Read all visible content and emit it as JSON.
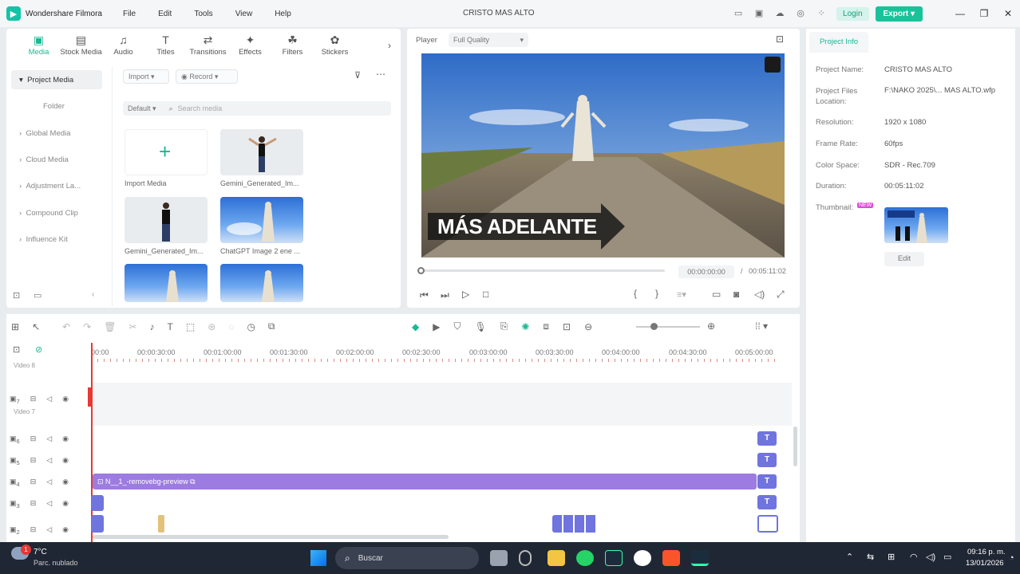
{
  "app": {
    "name": "Wondershare Filmora",
    "project_title": "CRISTO MAS ALTO"
  },
  "menu": [
    "File",
    "Edit",
    "Tools",
    "View",
    "Help"
  ],
  "titlebar": {
    "login": "Login",
    "export": "Export"
  },
  "media_tabs": [
    {
      "label": "Media",
      "icon": "media-icon"
    },
    {
      "label": "Stock Media",
      "icon": "stock-media-icon"
    },
    {
      "label": "Audio",
      "icon": "audio-icon"
    },
    {
      "label": "Titles",
      "icon": "titles-icon"
    },
    {
      "label": "Transitions",
      "icon": "transitions-icon"
    },
    {
      "label": "Effects",
      "icon": "effects-icon"
    },
    {
      "label": "Filters",
      "icon": "filters-icon"
    },
    {
      "label": "Stickers",
      "icon": "stickers-icon"
    }
  ],
  "sidebar": {
    "items": [
      "Project Media",
      "Folder",
      "Global Media",
      "Cloud Media",
      "Adjustment La...",
      "Compound Clip",
      "Influence Kit"
    ]
  },
  "media": {
    "import": "Import",
    "record": "Record",
    "sort": "Default",
    "search_placeholder": "Search media",
    "items": [
      "Import Media",
      "Gemini_Generated_Im...",
      "Gemini_Generated_Im...",
      "ChatGPT Image 2 ene ..."
    ]
  },
  "player": {
    "label": "Player",
    "quality": "Full Quality",
    "overlay_text": "MÁS ADELANTE",
    "current_time": "00:00:00:00",
    "separator": "/",
    "total_time": "00:05:11:02"
  },
  "project_info": {
    "tab": "Project Info",
    "fields": [
      {
        "label": "Project Name:",
        "value": "CRISTO MAS ALTO"
      },
      {
        "label": "Project Files Location:",
        "value": "F:\\NAKO 2025\\... MAS ALTO.wfp"
      },
      {
        "label": "Resolution:",
        "value": "1920 x 1080"
      },
      {
        "label": "Frame Rate:",
        "value": "60fps"
      },
      {
        "label": "Color Space:",
        "value": "SDR - Rec.709"
      },
      {
        "label": "Duration:",
        "value": "00:05:11:02"
      }
    ],
    "thumbnail_label": "Thumbnail:",
    "new_badge": "NEW",
    "edit": "Edit"
  },
  "timeline": {
    "ticks": [
      "00:00",
      "00:00:30:00",
      "00:01:00:00",
      "00:01:30:00",
      "00:02:00:00",
      "00:02:30:00",
      "00:03:00:00",
      "00:03:30:00",
      "00:04:00:00",
      "00:04:30:00",
      "00:05:00:00"
    ],
    "tracks": [
      {
        "num": "8",
        "label": "Video 8"
      },
      {
        "num": "7",
        "label": "Video 7"
      },
      {
        "num": "6"
      },
      {
        "num": "5"
      },
      {
        "num": "4"
      },
      {
        "num": "3"
      },
      {
        "num": "2"
      }
    ],
    "clip_name": "N__1_-removebg-preview"
  },
  "taskbar": {
    "temp": "7°C",
    "weather": "Parc. nublado",
    "search": "Buscar",
    "time": "09:16 p. m.",
    "date": "13/01/2026",
    "notif": "1"
  }
}
